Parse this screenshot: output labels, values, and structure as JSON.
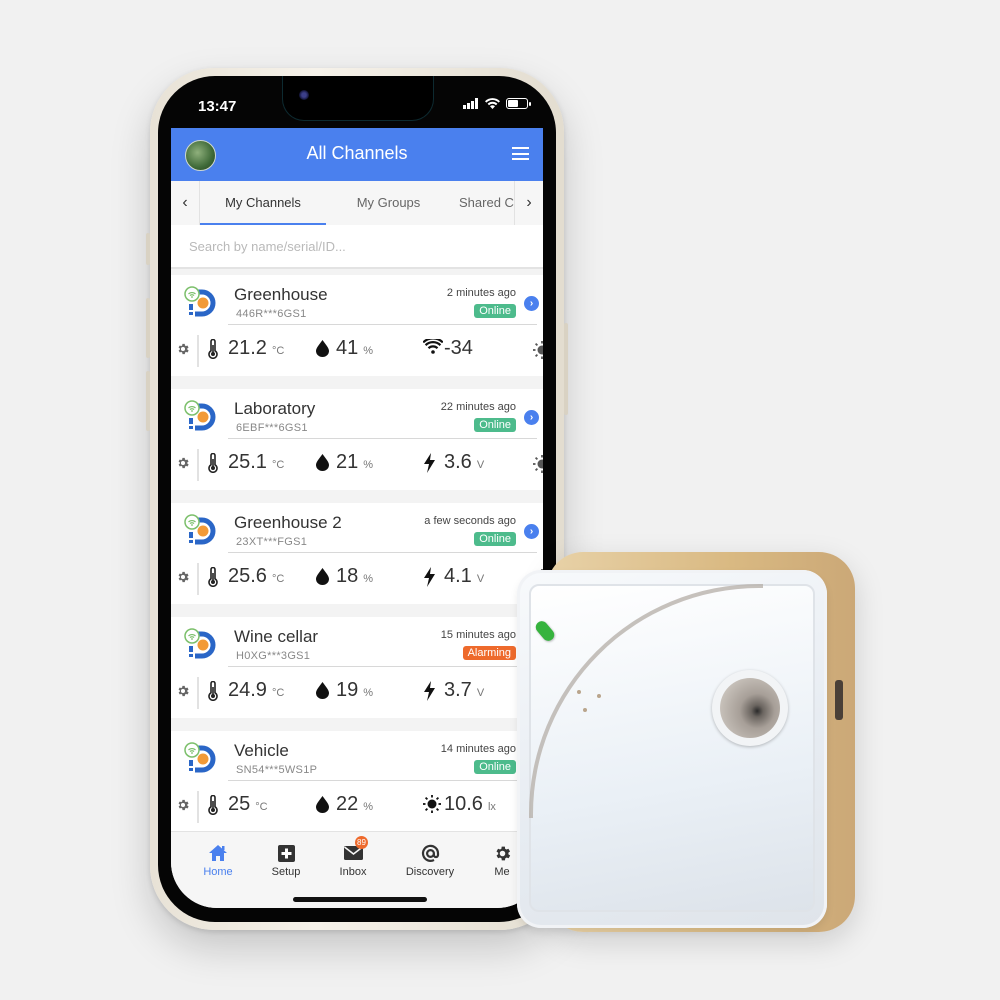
{
  "status_bar": {
    "time": "13:47"
  },
  "header": {
    "title": "All Channels"
  },
  "tabs": [
    {
      "label": "My Channels",
      "active": true
    },
    {
      "label": "My Groups",
      "active": false
    },
    {
      "label": "Shared C",
      "active": false
    }
  ],
  "search": {
    "placeholder": "Search by name/serial/ID..."
  },
  "channels": [
    {
      "name": "Greenhouse",
      "serial": "446R***6GS1",
      "updated": "2 minutes ago",
      "status": "Online",
      "readings": [
        {
          "icon": "thermometer-icon",
          "value": "21.2",
          "unit": "°C"
        },
        {
          "icon": "humidity-drop-icon",
          "value": "41",
          "unit": "%"
        },
        {
          "icon": "wifi-signal-icon",
          "value": "-34",
          "unit": ""
        }
      ]
    },
    {
      "name": "Laboratory",
      "serial": "6EBF***6GS1",
      "updated": "22 minutes ago",
      "status": "Online",
      "readings": [
        {
          "icon": "thermometer-icon",
          "value": "25.1",
          "unit": "°C"
        },
        {
          "icon": "humidity-drop-icon",
          "value": "21",
          "unit": "%"
        },
        {
          "icon": "voltage-bolt-icon",
          "value": "3.6",
          "unit": "V"
        }
      ]
    },
    {
      "name": "Greenhouse 2",
      "serial": "23XT***FGS1",
      "updated": "a few seconds ago",
      "status": "Online",
      "readings": [
        {
          "icon": "thermometer-icon",
          "value": "25.6",
          "unit": "°C"
        },
        {
          "icon": "humidity-drop-icon",
          "value": "18",
          "unit": "%"
        },
        {
          "icon": "voltage-bolt-icon",
          "value": "4.1",
          "unit": "V"
        }
      ]
    },
    {
      "name": "Wine cellar",
      "serial": "H0XG***3GS1",
      "updated": "15 minutes ago",
      "status": "Alarming",
      "readings": [
        {
          "icon": "thermometer-icon",
          "value": "24.9",
          "unit": "°C"
        },
        {
          "icon": "humidity-drop-icon",
          "value": "19",
          "unit": "%"
        },
        {
          "icon": "voltage-bolt-icon",
          "value": "3.7",
          "unit": "V"
        }
      ]
    },
    {
      "name": "Vehicle",
      "serial": "SN54***5WS1P",
      "updated": "14 minutes ago",
      "status": "Online",
      "readings": [
        {
          "icon": "thermometer-icon",
          "value": "25",
          "unit": "°C"
        },
        {
          "icon": "humidity-drop-icon",
          "value": "22",
          "unit": "%"
        },
        {
          "icon": "light-sun-icon",
          "value": "10.6",
          "unit": "lx"
        }
      ]
    }
  ],
  "bottom_nav": [
    {
      "label": "Home",
      "icon": "home-icon",
      "active": true
    },
    {
      "label": "Setup",
      "icon": "plus-square-icon",
      "active": false
    },
    {
      "label": "Inbox",
      "icon": "envelope-icon",
      "active": false,
      "badge": "89"
    },
    {
      "label": "Discovery",
      "icon": "at-sign-icon",
      "active": false
    },
    {
      "label": "Me",
      "icon": "gear-icon",
      "active": false
    }
  ],
  "colors": {
    "accent": "#4a80ee",
    "online": "#4dbb8c",
    "alarming": "#ee6a2c",
    "led": "#36b33e"
  }
}
